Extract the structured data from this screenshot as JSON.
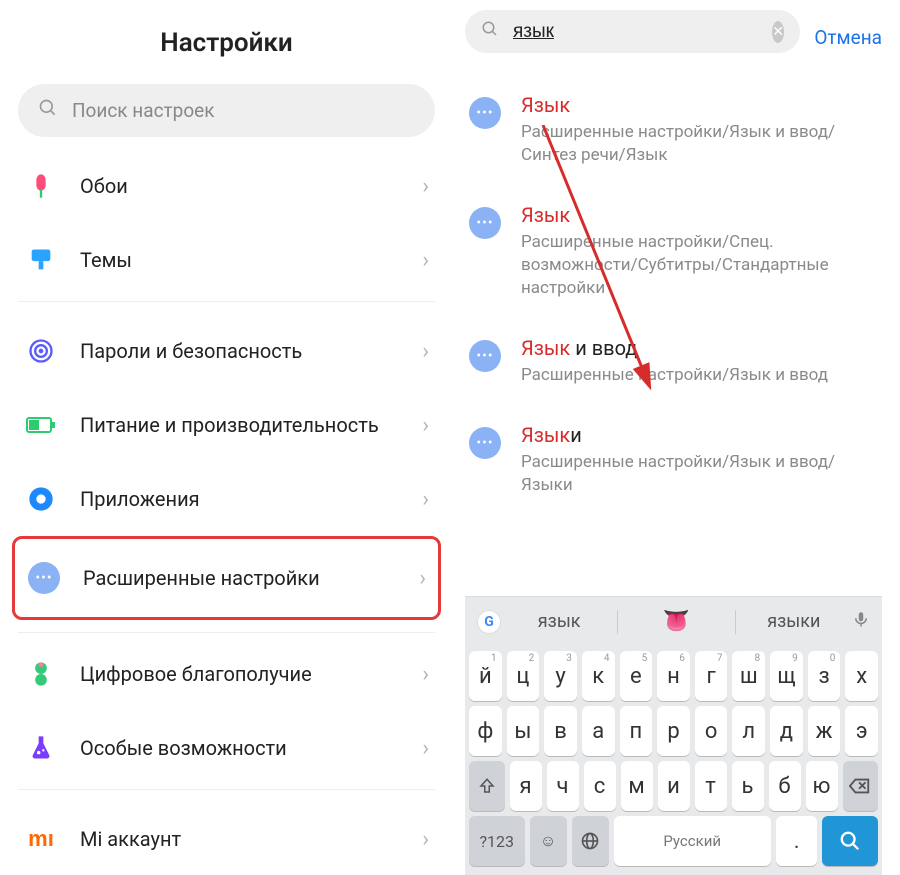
{
  "left": {
    "title": "Настройки",
    "search_placeholder": "Поиск настроек",
    "items": [
      {
        "label": "Обои"
      },
      {
        "label": "Темы"
      },
      {
        "label": "Пароли и безопасность"
      },
      {
        "label": "Питание и производительность"
      },
      {
        "label": "Приложения"
      },
      {
        "label": "Расширенные настройки"
      },
      {
        "label": "Цифровое благополучие"
      },
      {
        "label": "Особые возможности"
      },
      {
        "label": "Mi аккаунт"
      }
    ]
  },
  "right": {
    "search_value": "язык",
    "cancel": "Отмена",
    "results": [
      {
        "title_hl": "Язык",
        "title_plain": "",
        "path": "Расширенные настройки/Язык и ввод/Синтез речи/Язык"
      },
      {
        "title_hl": "Язык",
        "title_plain": "",
        "path": "Расширенные настройки/Спец. возможности/Субтитры/Стандартные настройки"
      },
      {
        "title_hl": "Язык",
        "title_plain": " и ввод",
        "path": "Расширенные настройки/Язык и ввод"
      },
      {
        "title_hl": "Язык",
        "title_plain": "и",
        "path": "Расширенные настройки/Язык и ввод/Языки"
      }
    ]
  },
  "keyboard": {
    "suggestions": [
      "язык",
      "языки"
    ],
    "tongue": "👅",
    "row1": [
      {
        "k": "й",
        "s": "1"
      },
      {
        "k": "ц",
        "s": "2"
      },
      {
        "k": "у",
        "s": "3"
      },
      {
        "k": "к",
        "s": "4"
      },
      {
        "k": "е",
        "s": "5"
      },
      {
        "k": "н",
        "s": "6"
      },
      {
        "k": "г",
        "s": "7"
      },
      {
        "k": "ш",
        "s": "8"
      },
      {
        "k": "щ",
        "s": "9"
      },
      {
        "k": "з",
        "s": "0"
      },
      {
        "k": "х",
        "s": ""
      }
    ],
    "row2": [
      "ф",
      "ы",
      "в",
      "а",
      "п",
      "р",
      "о",
      "л",
      "д",
      "ж",
      "э"
    ],
    "row3": [
      "я",
      "ч",
      "с",
      "м",
      "и",
      "т",
      "ь",
      "б",
      "ю"
    ],
    "symbols_label": "?123",
    "space_label": "Русский",
    "period": "."
  }
}
